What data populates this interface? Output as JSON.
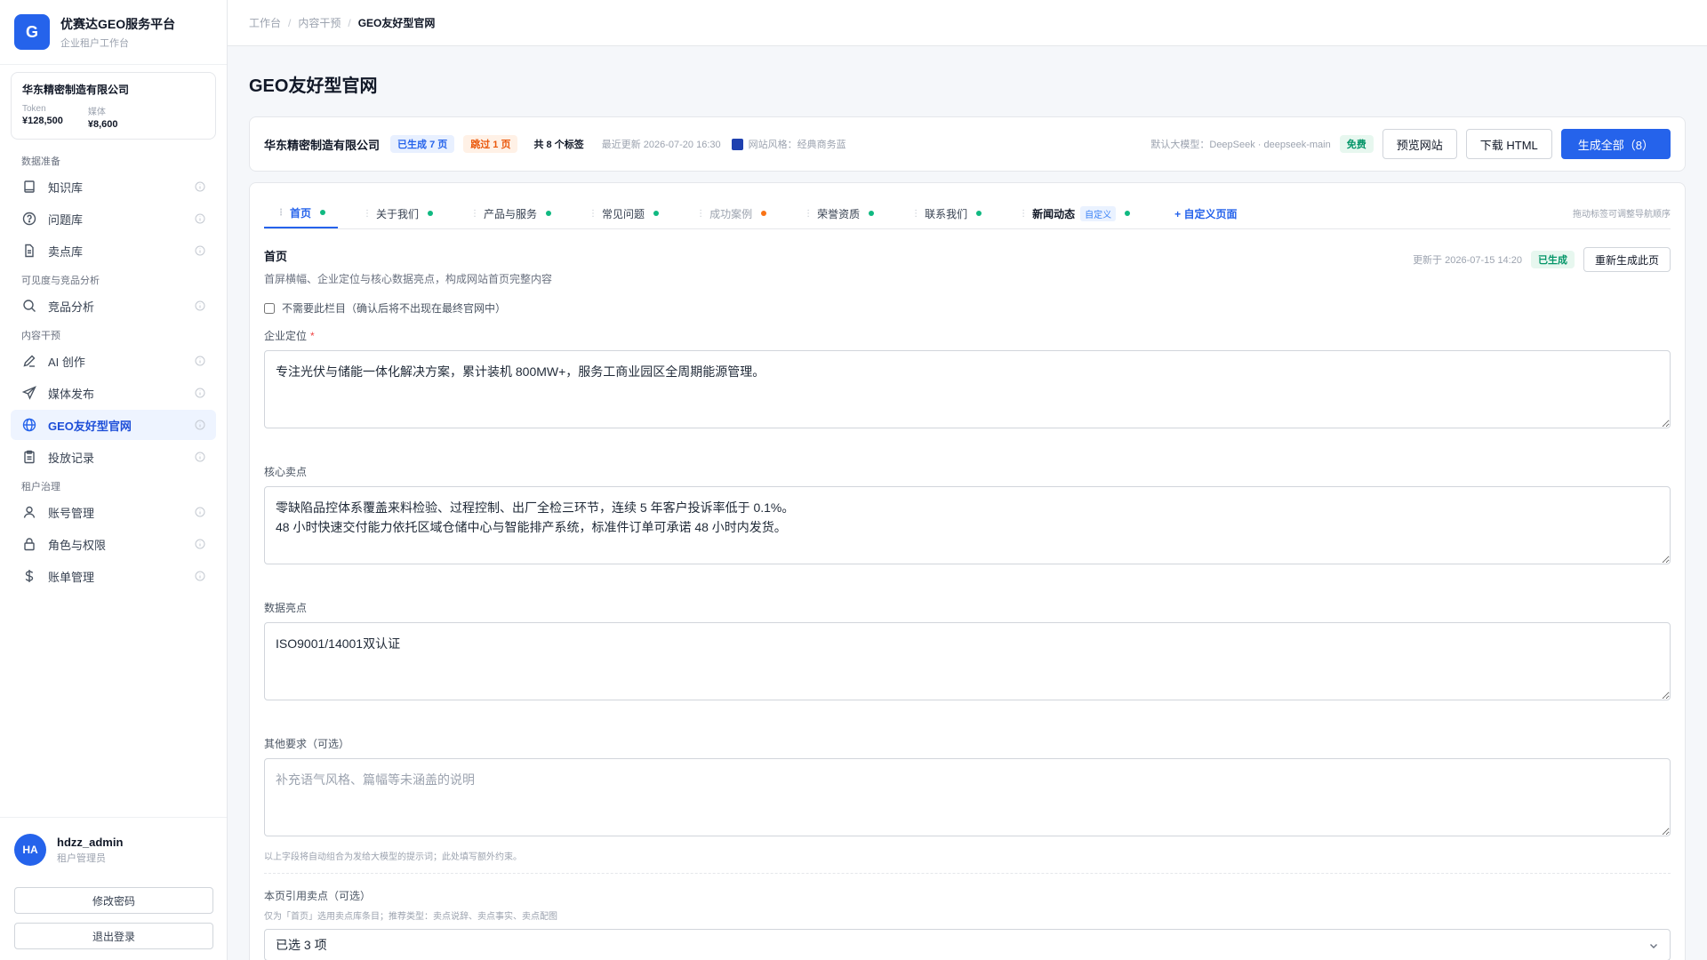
{
  "brand": {
    "logo_letter": "G",
    "title": "优赛达GEO服务平台",
    "subtitle": "企业租户工作台"
  },
  "tenant": {
    "name": "华东精密制造有限公司",
    "stats": [
      {
        "label": "Token",
        "value": "¥128,500"
      },
      {
        "label": "媒体",
        "value": "¥8,600"
      }
    ]
  },
  "nav": {
    "groups": [
      {
        "label": "数据准备"
      },
      {
        "label": "可见度与竞品分析"
      },
      {
        "label": "内容干预"
      },
      {
        "label": "租户治理"
      }
    ],
    "items": [
      {
        "label": "知识库",
        "icon": "book-icon"
      },
      {
        "label": "问题库",
        "icon": "question-icon"
      },
      {
        "label": "卖点库",
        "icon": "document-icon"
      },
      {
        "label": "竞品分析",
        "icon": "search-icon"
      },
      {
        "label": "AI 创作",
        "icon": "pen-icon"
      },
      {
        "label": "媒体发布",
        "icon": "send-icon"
      },
      {
        "label": "GEO友好型官网",
        "icon": "globe-icon",
        "active": true
      },
      {
        "label": "投放记录",
        "icon": "clipboard-icon"
      },
      {
        "label": "账号管理",
        "icon": "user-icon"
      },
      {
        "label": "角色与权限",
        "icon": "lock-icon"
      },
      {
        "label": "账单管理",
        "icon": "dollar-icon"
      }
    ]
  },
  "user": {
    "initials": "HA",
    "name": "hdzz_admin",
    "role": "租户管理员",
    "change_password": "修改密码",
    "logout": "退出登录"
  },
  "breadcrumb": {
    "items": [
      "工作台",
      "内容干预"
    ],
    "current": "GEO友好型官网",
    "separator": "/"
  },
  "page": {
    "title": "GEO友好型官网"
  },
  "summary": {
    "company": "华东精密制造有限公司",
    "generated_badge": "已生成 7 页",
    "skipped_badge": "跳过 1 页",
    "tag_count": "共 8 个标签",
    "last_updated": "最近更新 2026-07-20 16:30",
    "style_color": "#1e40af",
    "style_text": "网站风格：经典商务蓝",
    "model": "默认大模型：DeepSeek · deepseek-main",
    "model_badge": "免费",
    "preview_btn": "预览网站",
    "download_btn": "下载 HTML",
    "generate_all_btn": "生成全部（8）"
  },
  "tabs": {
    "items": [
      {
        "label": "首页",
        "status": "green",
        "active": true
      },
      {
        "label": "关于我们",
        "status": "green"
      },
      {
        "label": "产品与服务",
        "status": "green"
      },
      {
        "label": "常见问题",
        "status": "green"
      },
      {
        "label": "成功案例",
        "status": "orange",
        "muted": true
      },
      {
        "label": "荣誉资质",
        "status": "green"
      },
      {
        "label": "联系我们",
        "status": "green"
      },
      {
        "label": "新闻动态",
        "status": "green",
        "tag": "自定义"
      }
    ],
    "add_label": "+ 自定义页面",
    "drag_hint": "拖动标签可调整导航顺序"
  },
  "section": {
    "title": "首页",
    "desc": "首屏横幅、企业定位与核心数据亮点，构成网站首页完整内容",
    "updated": "更新于 2026-07-15 14:20",
    "status_badge": "已生成",
    "regen_btn": "重新生成此页",
    "skip_checkbox": "不需要此栏目（确认后将不出现在最终官网中）"
  },
  "fields": {
    "positioning": {
      "label": "企业定位",
      "required": "*",
      "value": "专注光伏与储能一体化解决方案，累计装机 800MW+，服务工商业园区全周期能源管理。"
    },
    "selling_points": {
      "label": "核心卖点",
      "value": "零缺陷品控体系覆盖来料检验、过程控制、出厂全检三环节，连续 5 年客户投诉率低于 0.1%。\n48 小时快速交付能力依托区域仓储中心与智能排产系统，标准件订单可承诺 48 小时内发货。"
    },
    "highlights": {
      "label": "数据亮点",
      "value": "ISO9001/14001双认证"
    },
    "other": {
      "label": "其他要求（可选）",
      "placeholder": "补充语气风格、篇幅等未涵盖的说明"
    },
    "help": "以上字段将自动组合为发给大模型的提示词；此处填写额外约束。",
    "refs": {
      "label": "本页引用卖点（可选）",
      "hint": "仅为「首页」选用卖点库条目；推荐类型：卖点说辞、卖点事实、卖点配图",
      "value": "已选 3 项"
    }
  }
}
